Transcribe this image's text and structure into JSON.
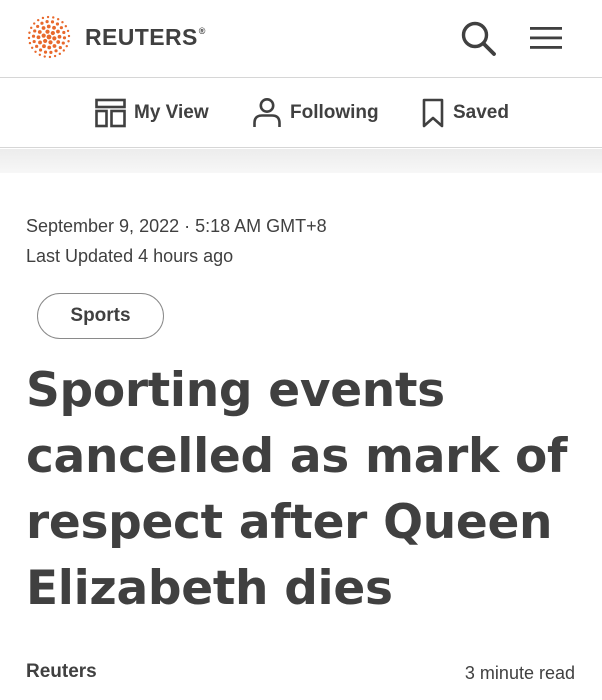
{
  "header": {
    "brand": "REUTERS",
    "brand_mark": "®",
    "logo_icon": "reuters-dots-logo",
    "search_icon": "search-icon",
    "menu_icon": "hamburger-menu-icon",
    "brand_color": "#e8692c"
  },
  "subnav": {
    "items": [
      {
        "label": "My View",
        "icon": "layout-icon"
      },
      {
        "label": "Following",
        "icon": "person-icon"
      },
      {
        "label": "Saved",
        "icon": "bookmark-icon"
      }
    ]
  },
  "article": {
    "dateline": "September 9, 2022 · 5:18 AM GMT+8",
    "updated": "Last Updated 4 hours ago",
    "tag": "Sports",
    "headline": "Sporting events cancelled as mark of respect after Queen Elizabeth dies",
    "byline": "Reuters",
    "read_time": "3 minute read"
  }
}
